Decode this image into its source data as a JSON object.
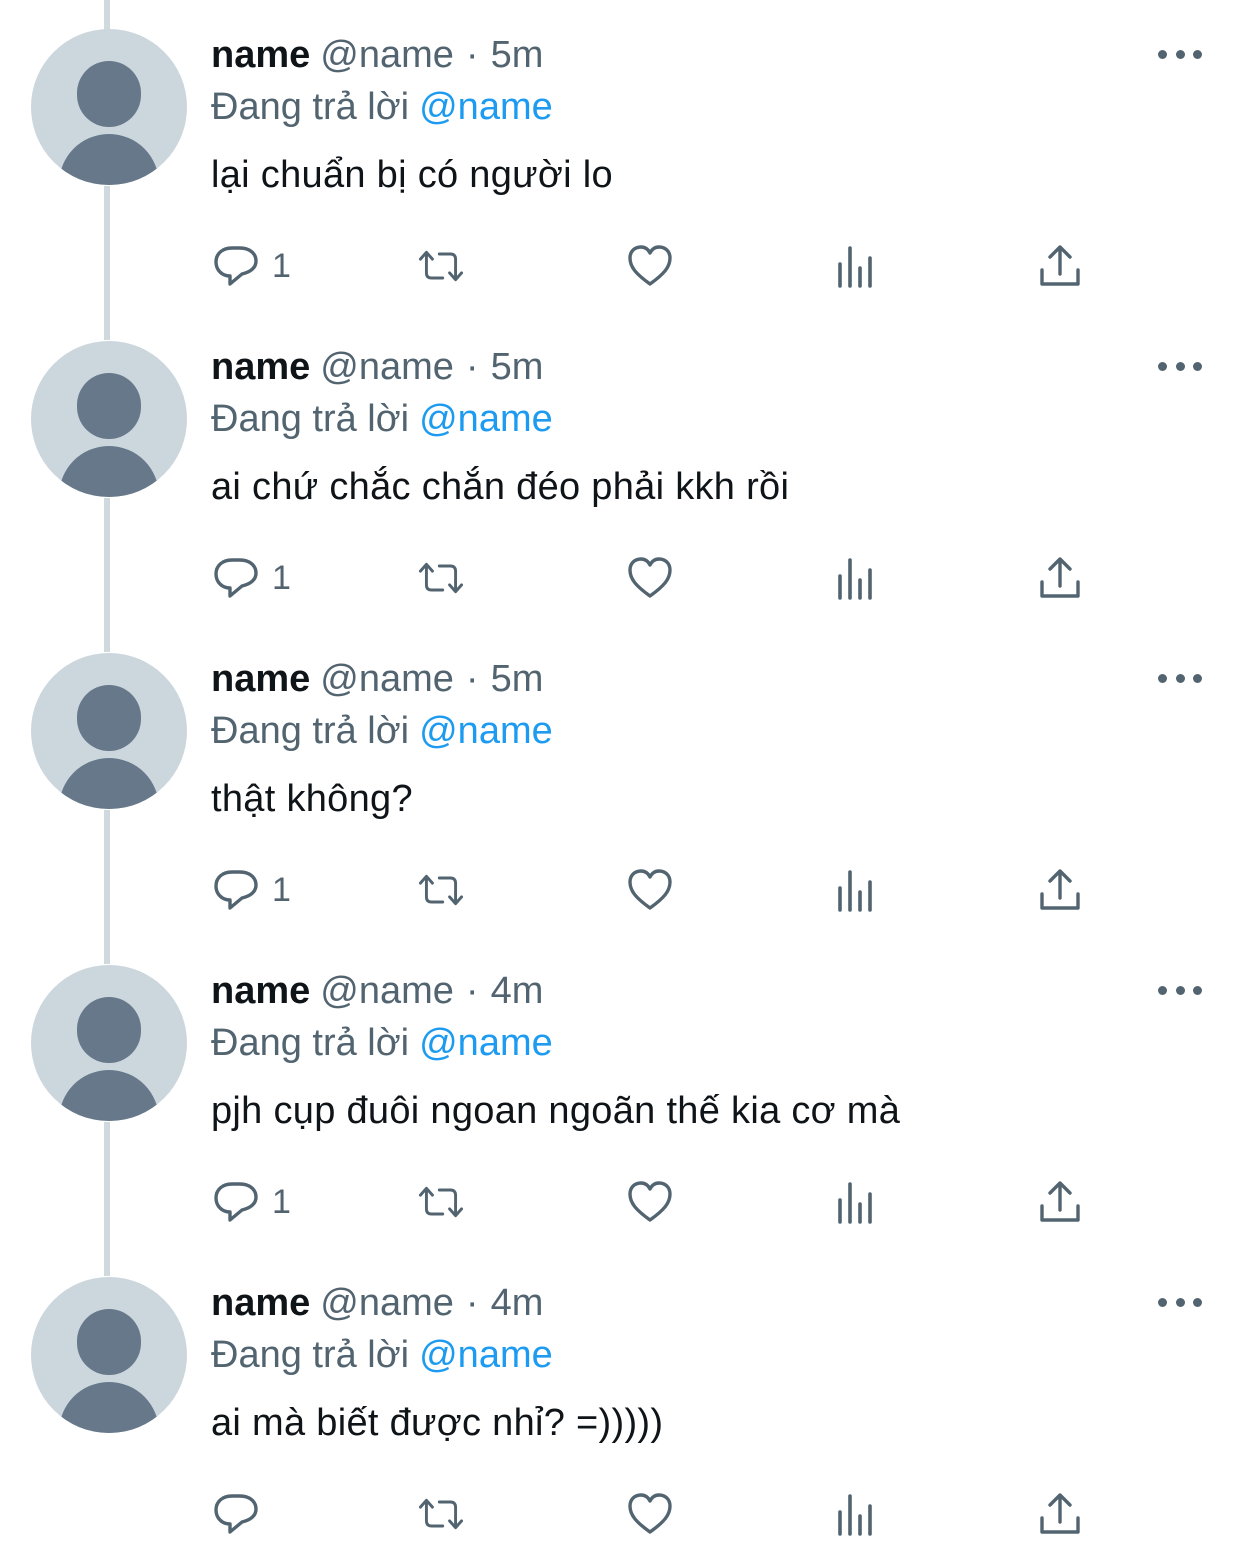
{
  "tweets": [
    {
      "name": "name",
      "handle": "@name",
      "dot": "·",
      "time": "5m",
      "replying_prefix": "Đang trả lời",
      "replying_to": "@name",
      "text": "lại chuẩn bị có người lo",
      "reply_count": "1"
    },
    {
      "name": "name",
      "handle": "@name",
      "dot": "·",
      "time": "5m",
      "replying_prefix": "Đang trả lời",
      "replying_to": "@name",
      "text": "ai chứ chắc chắn đéo phải kkh rồi",
      "reply_count": "1"
    },
    {
      "name": "name",
      "handle": "@name",
      "dot": "·",
      "time": "5m",
      "replying_prefix": "Đang trả lời",
      "replying_to": "@name",
      "text": "thật không?",
      "reply_count": "1"
    },
    {
      "name": "name",
      "handle": "@name",
      "dot": "·",
      "time": "4m",
      "replying_prefix": "Đang trả lời",
      "replying_to": "@name",
      "text": "pjh cụp đuôi ngoan ngoãn thế kia cơ mà",
      "reply_count": "1"
    },
    {
      "name": "name",
      "handle": "@name",
      "dot": "·",
      "time": "4m",
      "replying_prefix": "Đang trả lời",
      "replying_to": "@name",
      "text": "ai mà biết được nhỉ? =)))))",
      "reply_count": ""
    }
  ],
  "icons": {
    "reply": "reply-icon",
    "retweet": "retweet-icon",
    "like": "heart-icon",
    "views": "views-icon",
    "share": "share-icon",
    "more": "more-icon"
  },
  "colors": {
    "text": "#0f1419",
    "secondary": "#536471",
    "link": "#1d9bf0",
    "avatar_bg": "#ccd6dd",
    "avatar_fg": "#66788a",
    "thread_line": "#cfd9de"
  }
}
